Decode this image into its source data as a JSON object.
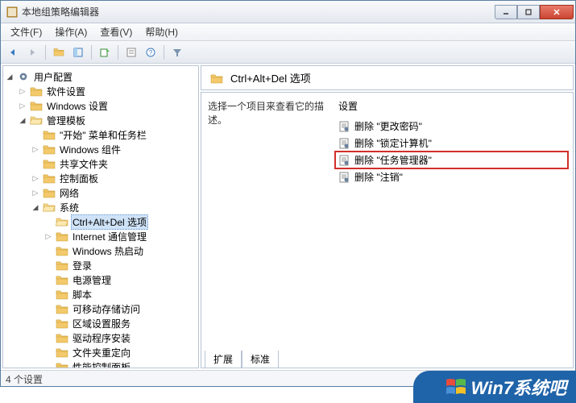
{
  "window": {
    "title": "本地组策略编辑器"
  },
  "menus": {
    "file": "文件(F)",
    "action": "操作(A)",
    "view": "查看(V)",
    "help": "帮助(H)"
  },
  "tree": {
    "root": "用户配置",
    "n1": "软件设置",
    "n2": "Windows 设置",
    "n3": "管理模板",
    "n3_1": "\"开始\" 菜单和任务栏",
    "n3_2": "Windows 组件",
    "n3_3": "共享文件夹",
    "n3_4": "控制面板",
    "n3_5": "网络",
    "n3_6": "系统",
    "n3_6_1": "Ctrl+Alt+Del 选项",
    "n3_6_2": "Internet 通信管理",
    "n3_6_3": "Windows 热启动",
    "n3_6_4": "登录",
    "n3_6_5": "电源管理",
    "n3_6_6": "脚本",
    "n3_6_7": "可移动存储访问",
    "n3_6_8": "区域设置服务",
    "n3_6_9": "驱动程序安装",
    "n3_6_10": "文件夹重定向",
    "n3_6_11": "性能控制面板"
  },
  "header": {
    "title": "Ctrl+Alt+Del 选项"
  },
  "detail": {
    "prompt": "选择一个项目来查看它的描述。",
    "col_header": "设置",
    "items": {
      "i1": "删除 \"更改密码\"",
      "i2": "删除 \"锁定计算机\"",
      "i3": "删除 \"任务管理器\"",
      "i4": "删除 \"注销\""
    }
  },
  "tabs": {
    "extended": "扩展",
    "standard": "标准"
  },
  "status": "4 个设置",
  "watermark": "Win7系统吧"
}
